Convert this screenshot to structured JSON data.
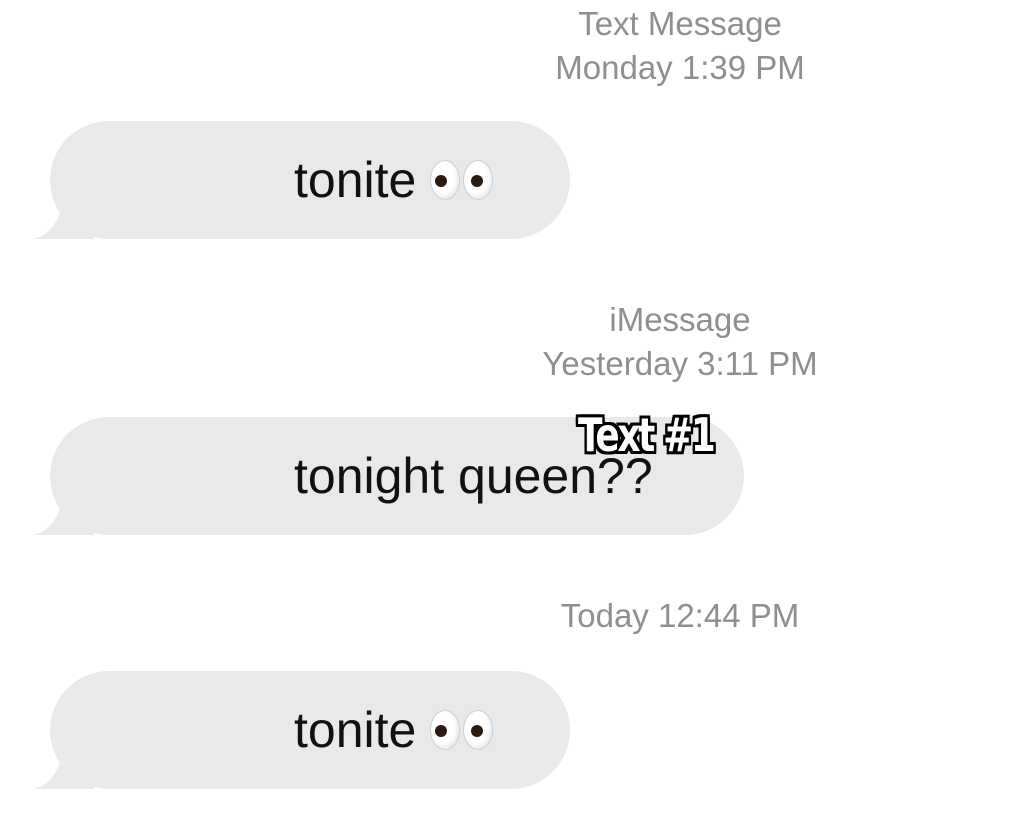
{
  "thread": [
    {
      "header": {
        "service": "Text Message",
        "timestamp": "Monday 1:39 PM"
      },
      "message": {
        "text": "tonite",
        "emoji": "eyes-icon"
      }
    },
    {
      "header": {
        "service": "iMessage",
        "timestamp": "Yesterday 3:11 PM"
      },
      "message": {
        "text": "tonight queen??",
        "emoji": ""
      }
    },
    {
      "header": {
        "service": "",
        "timestamp": "Today 12:44 PM"
      },
      "message": {
        "text": "tonite",
        "emoji": "eyes-icon"
      }
    }
  ],
  "overlay": {
    "caption": "Text #1"
  },
  "colors": {
    "background": "#ffffff",
    "incoming_bubble": "#e9e9eb",
    "metadata_text": "#8e8e93",
    "message_text": "#111111"
  }
}
